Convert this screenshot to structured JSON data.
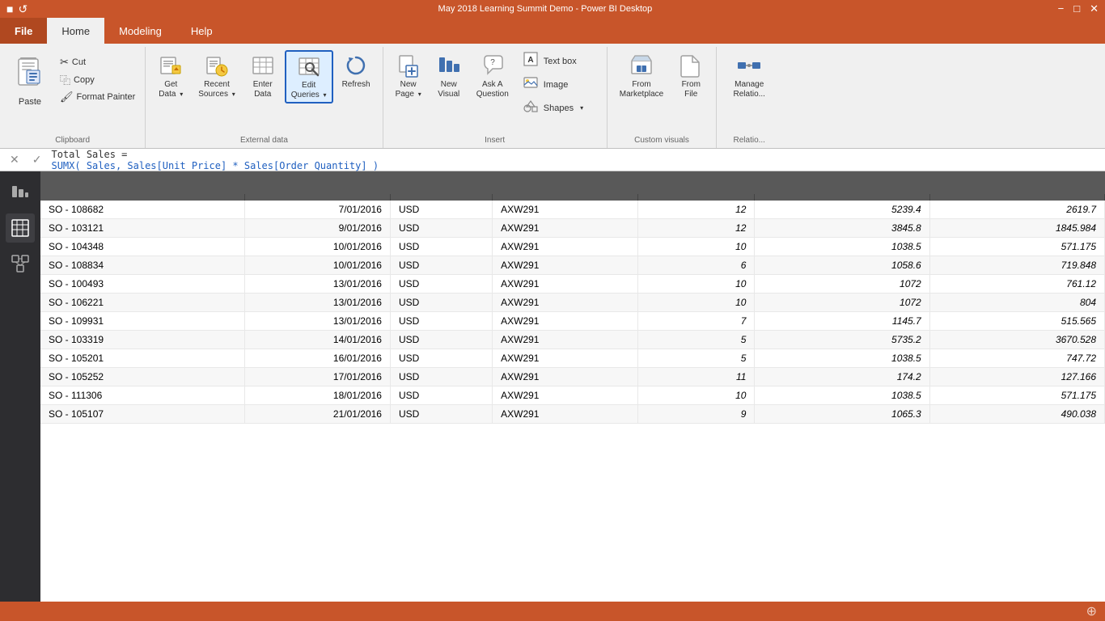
{
  "titlebar": {
    "text": "May 2018 Learning Summit Demo - Power BI Desktop"
  },
  "tabs": [
    {
      "label": "File",
      "active": false
    },
    {
      "label": "Home",
      "active": true
    },
    {
      "label": "Modeling",
      "active": false
    },
    {
      "label": "Help",
      "active": false
    }
  ],
  "ribbon": {
    "sections": {
      "clipboard": {
        "label": "Clipboard",
        "paste_label": "Paste",
        "cut_label": "Cut",
        "copy_label": "Copy",
        "format_painter_label": "Format Painter"
      },
      "external_data": {
        "label": "External data",
        "get_data_label": "Get\nData",
        "recent_sources_label": "Recent\nSources",
        "enter_data_label": "Enter\nData",
        "edit_queries_label": "Edit\nQueries",
        "refresh_label": "Refresh"
      },
      "insert": {
        "label": "Insert",
        "new_page_label": "New\nPage",
        "new_visual_label": "New\nVisual",
        "ask_question_label": "Ask A\nQuestion",
        "text_box_label": "Text box",
        "image_label": "Image",
        "shapes_label": "Shapes"
      },
      "custom_visuals": {
        "label": "Custom visuals",
        "from_marketplace_label": "From\nMarketplace",
        "from_file_label": "From\nFile"
      },
      "relationships": {
        "label": "Relationships",
        "manage_label": "Manage\nRelatio..."
      }
    }
  },
  "formula_bar": {
    "cancel_label": "✕",
    "confirm_label": "✓",
    "formula_line1": "Total Sales =",
    "formula_line2": "SUMX( Sales, Sales[Unit Price] * Sales[Order Quantity] )"
  },
  "sidebar_icons": [
    {
      "name": "report-icon",
      "symbol": "📊"
    },
    {
      "name": "data-icon",
      "symbol": "⊞"
    },
    {
      "name": "model-icon",
      "symbol": "⊟"
    }
  ],
  "table": {
    "headers": [
      "",
      "",
      "",
      "",
      "",
      "",
      ""
    ],
    "rows": [
      {
        "col1": "SO - 108682",
        "col2": "7/01/2016",
        "col3": "USD",
        "col4": "AXW291",
        "col5": "12",
        "col6": "5239.4",
        "col7": "2619.7"
      },
      {
        "col1": "SO - 103121",
        "col2": "9/01/2016",
        "col3": "USD",
        "col4": "AXW291",
        "col5": "12",
        "col6": "3845.8",
        "col7": "1845.984"
      },
      {
        "col1": "SO - 104348",
        "col2": "10/01/2016",
        "col3": "USD",
        "col4": "AXW291",
        "col5": "10",
        "col6": "1038.5",
        "col7": "571.175"
      },
      {
        "col1": "SO - 108834",
        "col2": "10/01/2016",
        "col3": "USD",
        "col4": "AXW291",
        "col5": "6",
        "col6": "1058.6",
        "col7": "719.848"
      },
      {
        "col1": "SO - 100493",
        "col2": "13/01/2016",
        "col3": "USD",
        "col4": "AXW291",
        "col5": "10",
        "col6": "1072",
        "col7": "761.12"
      },
      {
        "col1": "SO - 106221",
        "col2": "13/01/2016",
        "col3": "USD",
        "col4": "AXW291",
        "col5": "10",
        "col6": "1072",
        "col7": "804"
      },
      {
        "col1": "SO - 109931",
        "col2": "13/01/2016",
        "col3": "USD",
        "col4": "AXW291",
        "col5": "7",
        "col6": "1145.7",
        "col7": "515.565"
      },
      {
        "col1": "SO - 103319",
        "col2": "14/01/2016",
        "col3": "USD",
        "col4": "AXW291",
        "col5": "5",
        "col6": "5735.2",
        "col7": "3670.528"
      },
      {
        "col1": "SO - 105201",
        "col2": "16/01/2016",
        "col3": "USD",
        "col4": "AXW291",
        "col5": "5",
        "col6": "1038.5",
        "col7": "747.72"
      },
      {
        "col1": "SO - 105252",
        "col2": "17/01/2016",
        "col3": "USD",
        "col4": "AXW291",
        "col5": "11",
        "col6": "174.2",
        "col7": "127.166"
      },
      {
        "col1": "SO - 111306",
        "col2": "18/01/2016",
        "col3": "USD",
        "col4": "AXW291",
        "col5": "10",
        "col6": "1038.5",
        "col7": "571.175"
      },
      {
        "col1": "SO - 105107",
        "col2": "21/01/2016",
        "col3": "USD",
        "col4": "AXW291",
        "col5": "9",
        "col6": "1065.3",
        "col7": "490.038"
      }
    ]
  },
  "status_bar": {
    "text": ""
  }
}
